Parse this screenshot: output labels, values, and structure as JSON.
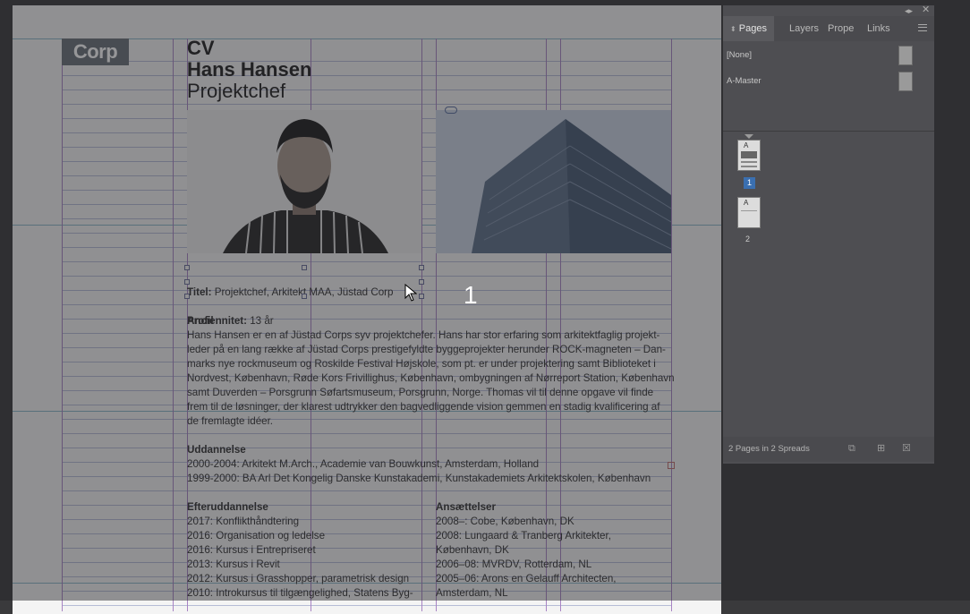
{
  "document": {
    "logo": "Corp",
    "title_lines": [
      "CV",
      "Hans Hansen",
      "Projektchef"
    ],
    "title_label": "Titel:",
    "title_value": " Projektchef, Arkitekt MAA, Jüstad Corp",
    "seniority_label": "Anciennitet:",
    "seniority_value": " 13 år",
    "profile_heading": "Profil",
    "profile_text": "Hans Hansen er en af Jüstad Corps syv projektchefer. Hans har stor erfaring som arkitektfaglig projekt-\nleder på en lang række af Jüstad Corps prestigefyldte byggeprojekter herunder ROCK-magneten – Dan-\nmarks nye rockmuseum og Roskilde Festival Højskole, som pt. er under projektering samt Biblioteket i\nNordvest, København, Røde Kors Frivillighus, København, ombygningen af Nørreport Station, København\nsamt Duverden – Porsgrunn Søfartsmuseum, Porsgrunn, Norge. Thomas vil til denne opgave vil finde\nfrem til de løsninger, der klarest udtrykker den bagvedliggende vision gemmen en stadig kvalificering af\nde fremlagte idéer.",
    "education_heading": "Uddannelse",
    "education": [
      "2000-2004: Arkitekt M.Arch., Academie van Bouwkunst, Amsterdam, Holland",
      "1999-2000: BA Arl Det Kongelig Danske Kunstakademi, Kunstakademiets Arkitektskolen, København"
    ],
    "further_heading": "Efteruddannelse",
    "further": [
      "2017: Konflikthåndtering",
      "2016: Organisation og ledelse",
      "2016: Kursus i Entrepriseret",
      "2013: Kursus i Revit",
      "2012: Kursus i Grasshopper, parametrisk design",
      "2010: Introkursus til tilgængelighed, Statens Byg-"
    ],
    "employment_heading": "Ansættelser",
    "employment": [
      "2008–: Cobe, København, DK",
      "2008: Lungaard & Tranberg Arkitekter,",
      "København, DK",
      "2006–08: MVRDV, Rotterdam, NL",
      "2005–06: Arons en Gelauff Architecten,",
      "Amsterdam, NL"
    ],
    "page_number_overlay": "1"
  },
  "panel": {
    "tabs": [
      "Pages",
      "Layers",
      "Prope",
      "Links"
    ],
    "active_tab": "Pages",
    "masters": [
      "[None]",
      "A-Master"
    ],
    "pages": [
      {
        "number": "1",
        "master_prefix": "A",
        "selected": true
      },
      {
        "number": "2",
        "master_prefix": "A",
        "selected": false
      }
    ],
    "status": "2 Pages in 2 Spreads"
  },
  "icons": {
    "collapse": "double-arrow-icon",
    "close": "close-icon",
    "menu": "panel-menu-icon",
    "new_page": "new-page-icon",
    "delete": "trash-icon",
    "edit_size": "page-size-icon",
    "link": "link-icon",
    "cursor": "mouse-pointer-icon"
  },
  "colors": {
    "accent_selected_page": "#3a6fb0",
    "margin_guides": "#a884c4",
    "baseline_grid": "#b6bcd6",
    "logo_bg": "#6a7179"
  }
}
